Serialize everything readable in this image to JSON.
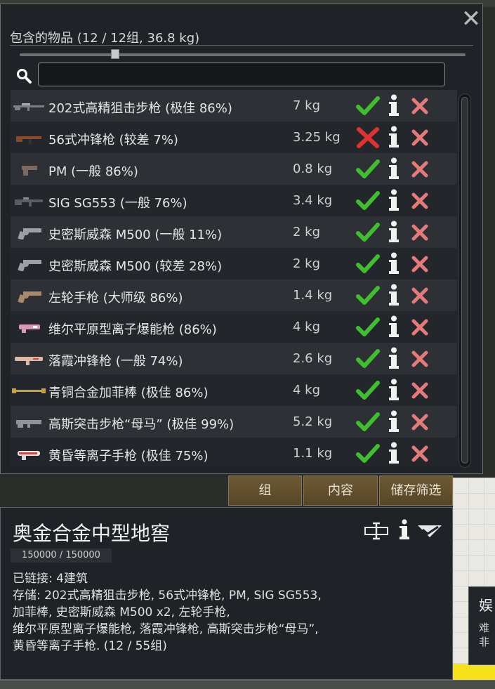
{
  "window": {
    "title": "包含的物品 (12 / 12组, 36.8 kg)",
    "close_glyph": "✕",
    "search_placeholder": ""
  },
  "items": [
    {
      "name": "202式高精狙击步枪 (极佳 86%)",
      "mass": "7 kg",
      "allowed": true,
      "icon": "sniper-rifle-icon",
      "color": "#7a7f85"
    },
    {
      "name": "56式冲锋枪 (较差 7%)",
      "mass": "3.25 kg",
      "allowed": false,
      "icon": "assault-rifle-icon",
      "color": "#8a4a2a"
    },
    {
      "name": "PM (一般 86%)",
      "mass": "0.8 kg",
      "allowed": true,
      "icon": "pistol-icon",
      "color": "#7b6a5d"
    },
    {
      "name": "SIG SG553 (一般 76%)",
      "mass": "3.4 kg",
      "allowed": true,
      "icon": "rifle-icon",
      "color": "#5a5e62"
    },
    {
      "name": "史密斯威森 M500 (一般 11%)",
      "mass": "2 kg",
      "allowed": true,
      "icon": "revolver-icon",
      "color": "#9aa0a5"
    },
    {
      "name": "史密斯威森 M500 (较差 28%)",
      "mass": "2 kg",
      "allowed": true,
      "icon": "revolver-icon",
      "color": "#9aa0a5"
    },
    {
      "name": "左轮手枪 (大师级 86%)",
      "mass": "1.4 kg",
      "allowed": true,
      "icon": "revolver-icon",
      "color": "#a88a6a"
    },
    {
      "name": "维尔平原型离子爆能枪 (86%)",
      "mass": "4 kg",
      "allowed": true,
      "icon": "ion-blaster-icon",
      "color": "#d69ab8"
    },
    {
      "name": "落霞冲锋枪 (一般 74%)",
      "mass": "2.6 kg",
      "allowed": true,
      "icon": "smg-icon",
      "color": "#e0b8a8"
    },
    {
      "name": "青铜合金加菲棒 (极佳 86%)",
      "mass": "4 kg",
      "allowed": true,
      "icon": "bronze-staff-icon",
      "color": "#c9a03a"
    },
    {
      "name": "高斯突击步枪“母马” (极佳 99%)",
      "mass": "5.2 kg",
      "allowed": true,
      "icon": "gauss-rifle-icon",
      "color": "#8e9398"
    },
    {
      "name": "黄昏等离子手枪 (极佳 75%)",
      "mass": "1.1 kg",
      "allowed": true,
      "icon": "plasma-pistol-icon",
      "color": "#c84a4a"
    }
  ],
  "tabs": {
    "group": "组",
    "contents": "内容",
    "storage_filter": "储存筛选"
  },
  "inspect": {
    "title": "奥金合金中型地窖",
    "hp": "150000 / 150000",
    "linked": "已链接: 4建筑",
    "storage_lines": [
      "存储: 202式高精狙击步枪, 56式冲锋枪, PM, SIG SG553,",
      "加菲棒, 史密斯威森 M500 x2, 左轮手枪,",
      "维尔平原型离子爆能枪, 落霞冲锋枪, 高斯突击步枪“母马”,",
      "黄昏等离子手枪. (12 / 55组)"
    ]
  },
  "tooltip": {
    "head": "娱",
    "line1": "难",
    "line2": "非"
  },
  "colors": {
    "allow_green": "#3fbf2f",
    "forbid_red": "#e03030",
    "drop_red": "#e47a7a",
    "tab_brown": "#5b4a2b"
  }
}
